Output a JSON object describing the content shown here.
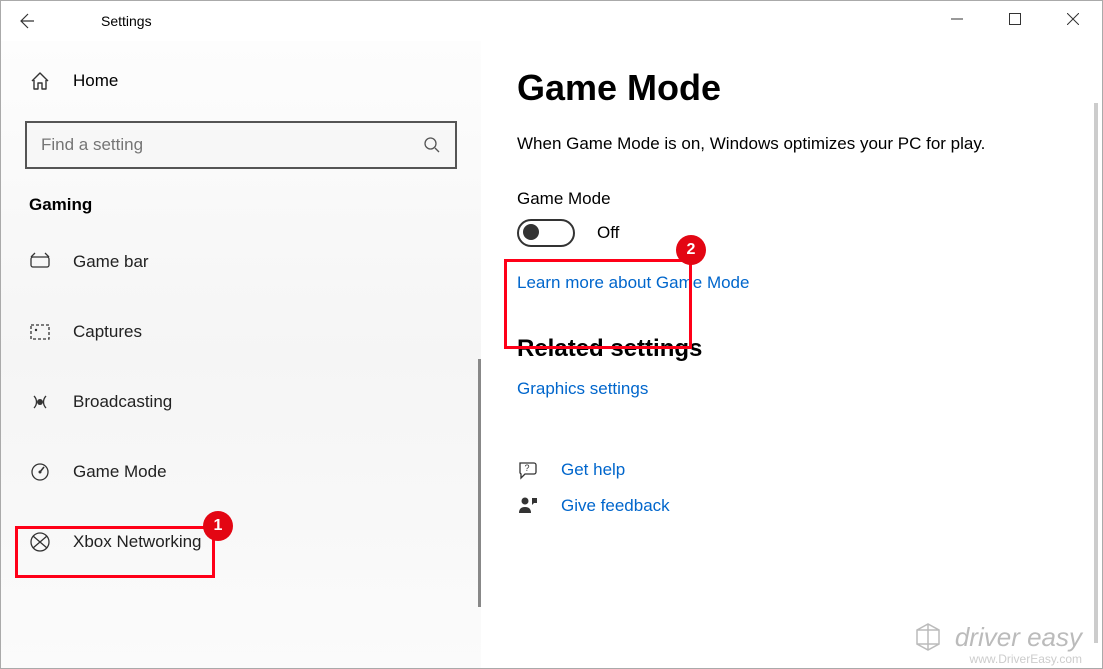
{
  "window": {
    "title": "Settings"
  },
  "sidebar": {
    "home_label": "Home",
    "search_placeholder": "Find a setting",
    "category": "Gaming",
    "items": [
      {
        "label": "Game bar"
      },
      {
        "label": "Captures"
      },
      {
        "label": "Broadcasting"
      },
      {
        "label": "Game Mode"
      },
      {
        "label": "Xbox Networking"
      }
    ]
  },
  "main": {
    "title": "Game Mode",
    "description": "When Game Mode is on, Windows optimizes your PC for play.",
    "toggle_label": "Game Mode",
    "toggle_state": "Off",
    "learn_link": "Learn more about Game Mode",
    "related_heading": "Related settings",
    "graphics_link": "Graphics settings",
    "get_help": "Get help",
    "give_feedback": "Give feedback"
  },
  "annotations": {
    "badge1": "1",
    "badge2": "2"
  },
  "watermark": {
    "brand": "driver easy",
    "url": "www.DriverEasy.com"
  }
}
